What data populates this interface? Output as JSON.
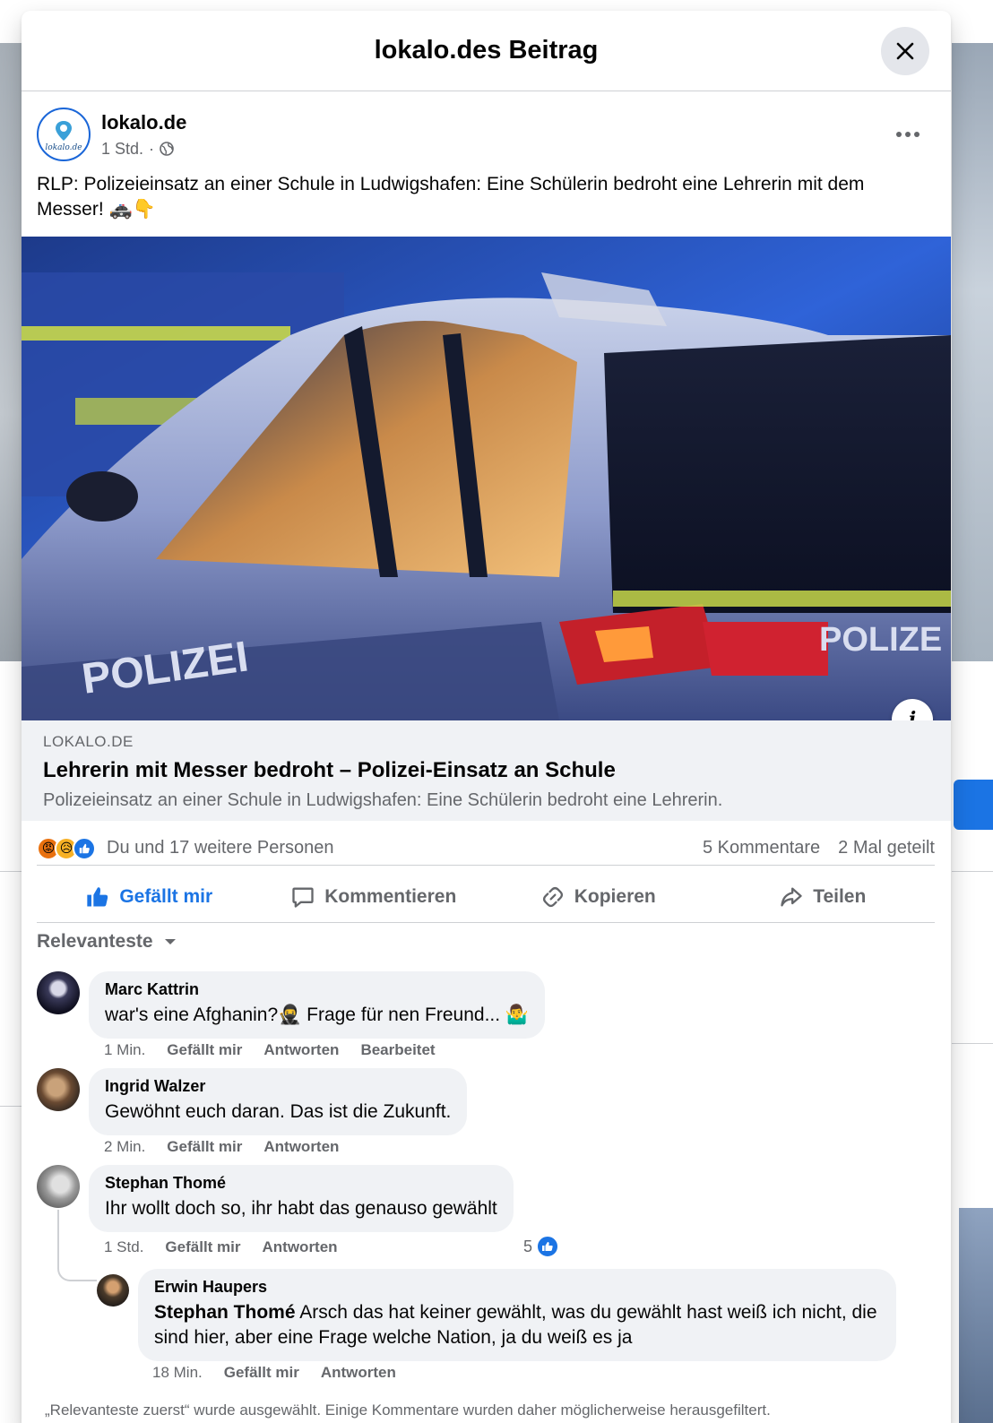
{
  "modal": {
    "title": "lokalo.des Beitrag"
  },
  "post": {
    "page_name": "lokalo.de",
    "avatar_text": "lokalo.de",
    "time": "1 Std.",
    "meta_separator": "·",
    "text": "RLP: Polizeieinsatz an einer Schule in Ludwigshafen: Eine Schülerin bedroht eine Lehrerin mit dem Messer! 🚓👇",
    "image_labels": [
      "POLIZEI",
      "POLIZE"
    ]
  },
  "link_card": {
    "domain": "LOKALO.DE",
    "title": "Lehrerin mit Messer bedroht – Polizei-Einsatz an Schule",
    "description": "Polizeieinsatz an einer Schule in Ludwigshafen: Eine Schülerin bedroht eine Lehrerin."
  },
  "stats": {
    "people": "Du und 17 weitere Personen",
    "comments": "5 Kommentare",
    "shares": "2 Mal geteilt"
  },
  "actions": {
    "like": "Gefällt mir",
    "comment": "Kommentieren",
    "copy": "Kopieren",
    "share": "Teilen"
  },
  "sort": {
    "label": "Relevanteste"
  },
  "comments": [
    {
      "name": "Marc Kattrin",
      "text": "war's eine Afghanin?🥷 Frage für nen Freund... 🤷‍♂️",
      "time": "1 Min.",
      "like": "Gefällt mir",
      "reply": "Antworten",
      "edited": "Bearbeitet"
    },
    {
      "name": "Ingrid Walzer",
      "text": "Gewöhnt euch daran. Das ist die Zukunft.",
      "time": "2 Min.",
      "like": "Gefällt mir",
      "reply": "Antworten"
    },
    {
      "name": "Stephan Thomé",
      "text": "Ihr wollt doch so, ihr habt das genauso gewählt",
      "time": "1 Std.",
      "like": "Gefällt mir",
      "reply": "Antworten",
      "likes": "5"
    }
  ],
  "reply": {
    "name": "Erwin Haupers",
    "mention": "Stephan Thomé",
    "text": " Arsch das hat keiner gewählt, was du gewählt hast weiß ich nicht, die sind hier, aber eine Frage welche Nation, ja du weiß es ja",
    "time": "18 Min.",
    "like": "Gefällt mir",
    "reply": "Antworten"
  },
  "footer": "„Relevanteste zuerst“ wurde ausgewählt. Einige Kommentare wurden daher möglicherweise herausgefiltert.",
  "colors": {
    "accent": "#1b74e4",
    "secondary_text": "#65676b",
    "bubble": "#f0f2f5"
  }
}
